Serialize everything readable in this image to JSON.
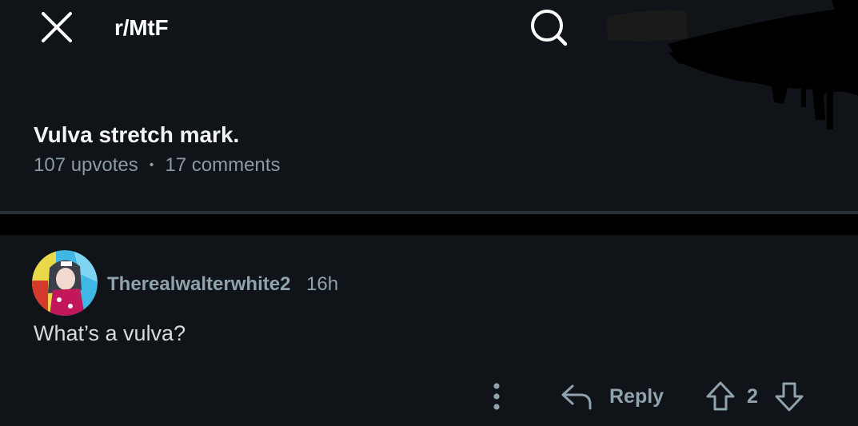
{
  "header": {
    "subreddit": "r/MtF",
    "close_icon": "close-icon",
    "search_icon": "search-icon"
  },
  "post": {
    "title": "Vulva stretch mark.",
    "upvotes": "107 upvotes",
    "separator": "•",
    "comments": "17 comments"
  },
  "comment": {
    "username": "Therealwalterwhite2",
    "time": "16h",
    "body": "What’s a vulva?",
    "actions": {
      "more_icon": "more-vertical-icon",
      "reply_icon": "reply-arrow-icon",
      "reply_label": "Reply",
      "upvote_icon": "upvote-arrow-icon",
      "score": "2",
      "downvote_icon": "downvote-arrow-icon"
    }
  },
  "colors": {
    "background": "#101418",
    "divider": "#000000",
    "muted_text": "#8fa2ad",
    "title_text": "#f2f4f5"
  }
}
